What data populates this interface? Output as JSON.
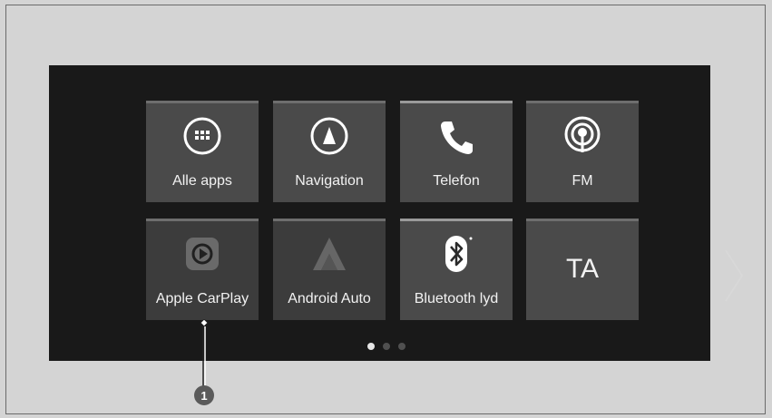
{
  "tiles": [
    {
      "label": "Alle apps",
      "icon": "grid-icon"
    },
    {
      "label": "Navigation",
      "icon": "compass-icon"
    },
    {
      "label": "Telefon",
      "icon": "phone-icon"
    },
    {
      "label": "FM",
      "icon": "radio-icon"
    },
    {
      "label": "Apple CarPlay",
      "icon": "carplay-icon"
    },
    {
      "label": "Android Auto",
      "icon": "android-auto-icon"
    },
    {
      "label": "Bluetooth lyd",
      "icon": "bluetooth-icon"
    },
    {
      "label": "TA",
      "icon": ""
    }
  ],
  "pager": {
    "pages": 3,
    "active": 1
  },
  "callout": {
    "number": "1"
  },
  "colors": {
    "background": "#d4d4d4",
    "screen": "#191919",
    "tile": "#4a4a4a"
  }
}
